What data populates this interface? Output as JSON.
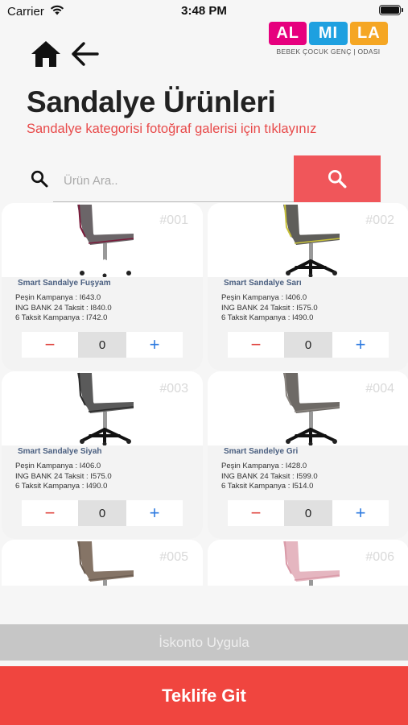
{
  "status_bar": {
    "carrier": "Carrier",
    "time": "3:48 PM"
  },
  "nav": {
    "home_icon": "home-icon",
    "back_icon": "arrow-left-icon"
  },
  "logo": {
    "blocks": [
      "AL",
      "MI",
      "LA"
    ],
    "colors": [
      "#e6007e",
      "#1ea0e0",
      "#f5a623"
    ],
    "tagline": "BEBEK ÇOCUK GENÇ | ODASI"
  },
  "header": {
    "title": "Sandalye Ürünleri",
    "subtitle": "Sandalye kategorisi fotoğraf galerisi için tıklayınız"
  },
  "search": {
    "placeholder": "Ürün Ara..",
    "value": "",
    "icon": "search-icon",
    "button_icon": "search-icon"
  },
  "products": [
    {
      "number": "#001",
      "name": "Smart Sandalye Fuşyam",
      "prices": [
        "Peşin Kampanya : I643.0",
        "ING BANK 24 Taksit : I840.0",
        "6 Taksit Kampanya : I742.0"
      ],
      "quantity": "0",
      "seat_color": "#6b6568",
      "accent": "#7a1a3a",
      "base": "#ffffff"
    },
    {
      "number": "#002",
      "name": "Smart Sandalye Sarı",
      "prices": [
        "Peşin Kampanya : I406.0",
        "ING BANK 24 Taksit : I575.0",
        "6 Taksit Kampanya : I490.0"
      ],
      "quantity": "0",
      "seat_color": "#5f5e5a",
      "accent": "#c9c23a",
      "base": "#111111"
    },
    {
      "number": "#003",
      "name": "Smart Sandalye Siyah",
      "prices": [
        "Peşin Kampanya : I406.0",
        "ING BANK 24 Taksit : I575.0",
        "6 Taksit Kampanya : I490.0"
      ],
      "quantity": "0",
      "seat_color": "#5a5a5a",
      "accent": "#2a2a2a",
      "base": "#111111"
    },
    {
      "number": "#004",
      "name": "Smart Sandelye Gri",
      "prices": [
        "Peşin Kampanya : I428.0",
        "ING BANK 24 Taksit : I599.0",
        "6 Taksit Kampanya : I514.0"
      ],
      "quantity": "0",
      "seat_color": "#6e6a66",
      "accent": "#8a8580",
      "base": "#111111"
    },
    {
      "number": "#005",
      "seat_color": "#857466",
      "accent": "#6b5d52",
      "base": "#111111"
    },
    {
      "number": "#006",
      "seat_color": "#e5b6c0",
      "accent": "#d99aa8",
      "base": "#cccccc"
    }
  ],
  "stepper": {
    "minus": "−",
    "plus": "+"
  },
  "footer": {
    "discount_label": "İskonto Uygula",
    "offer_label": "Teklife Git"
  }
}
